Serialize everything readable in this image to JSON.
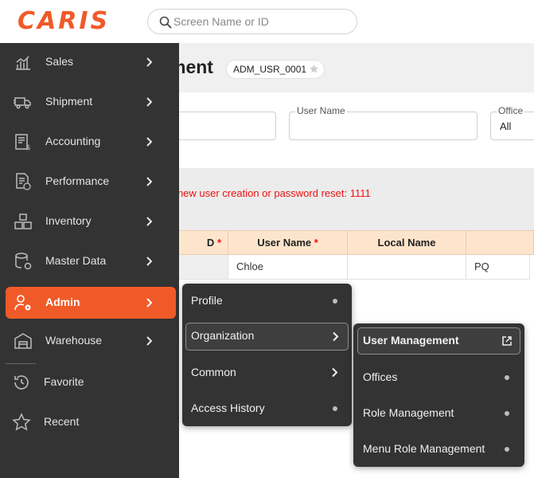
{
  "header": {
    "logo_text": "CARIS",
    "search_placeholder": "Screen Name or ID",
    "brand_color": "#f05a28"
  },
  "page": {
    "title_partial": "ment",
    "screen_id": "ADM_USR_0001",
    "filters": [
      {
        "label": "",
        "value": ""
      },
      {
        "label": "User Name",
        "value": ""
      },
      {
        "label": "Office",
        "value": "All"
      }
    ],
    "notice": "r new user creation or password reset: 1111",
    "grid": {
      "headers": [
        {
          "label": "D",
          "required": "*"
        },
        {
          "label": "User Name",
          "required": "*"
        },
        {
          "label": "Local Name",
          "required": ""
        },
        {
          "label": "",
          "required": ""
        }
      ],
      "row": [
        "",
        "Chloe",
        "",
        "PQ"
      ]
    }
  },
  "sidebar": {
    "items": [
      {
        "label": "Sales",
        "icon": "sales-chart-icon",
        "has_children": true
      },
      {
        "label": "Shipment",
        "icon": "truck-icon",
        "has_children": true
      },
      {
        "label": "Accounting",
        "icon": "ledger-dollar-icon",
        "has_children": true
      },
      {
        "label": "Performance",
        "icon": "report-dollar-icon",
        "has_children": true
      },
      {
        "label": "Inventory",
        "icon": "boxes-icon",
        "has_children": true
      },
      {
        "label": "Master Data",
        "icon": "database-gear-icon",
        "has_children": true
      },
      {
        "label": "Admin",
        "icon": "user-gear-icon",
        "has_children": true,
        "active": true
      },
      {
        "label": "Warehouse",
        "icon": "warehouse-icon",
        "has_children": true
      },
      {
        "label": "Favorite",
        "icon": "history-icon",
        "has_children": false
      },
      {
        "label": "Recent",
        "icon": "star-outline-icon",
        "has_children": false
      }
    ]
  },
  "admin_menu": {
    "items": [
      {
        "label": "Profile",
        "type": "dot"
      },
      {
        "label": "Organization",
        "type": "chevron",
        "active": true
      },
      {
        "label": "Common",
        "type": "chevron"
      },
      {
        "label": "Access History",
        "type": "dot"
      }
    ]
  },
  "organization_menu": {
    "items": [
      {
        "label": "User Management",
        "type": "external",
        "active": true
      },
      {
        "label": "Offices",
        "type": "dot"
      },
      {
        "label": "Role Management",
        "type": "dot"
      },
      {
        "label": "Menu Role Management",
        "type": "dot"
      }
    ]
  }
}
